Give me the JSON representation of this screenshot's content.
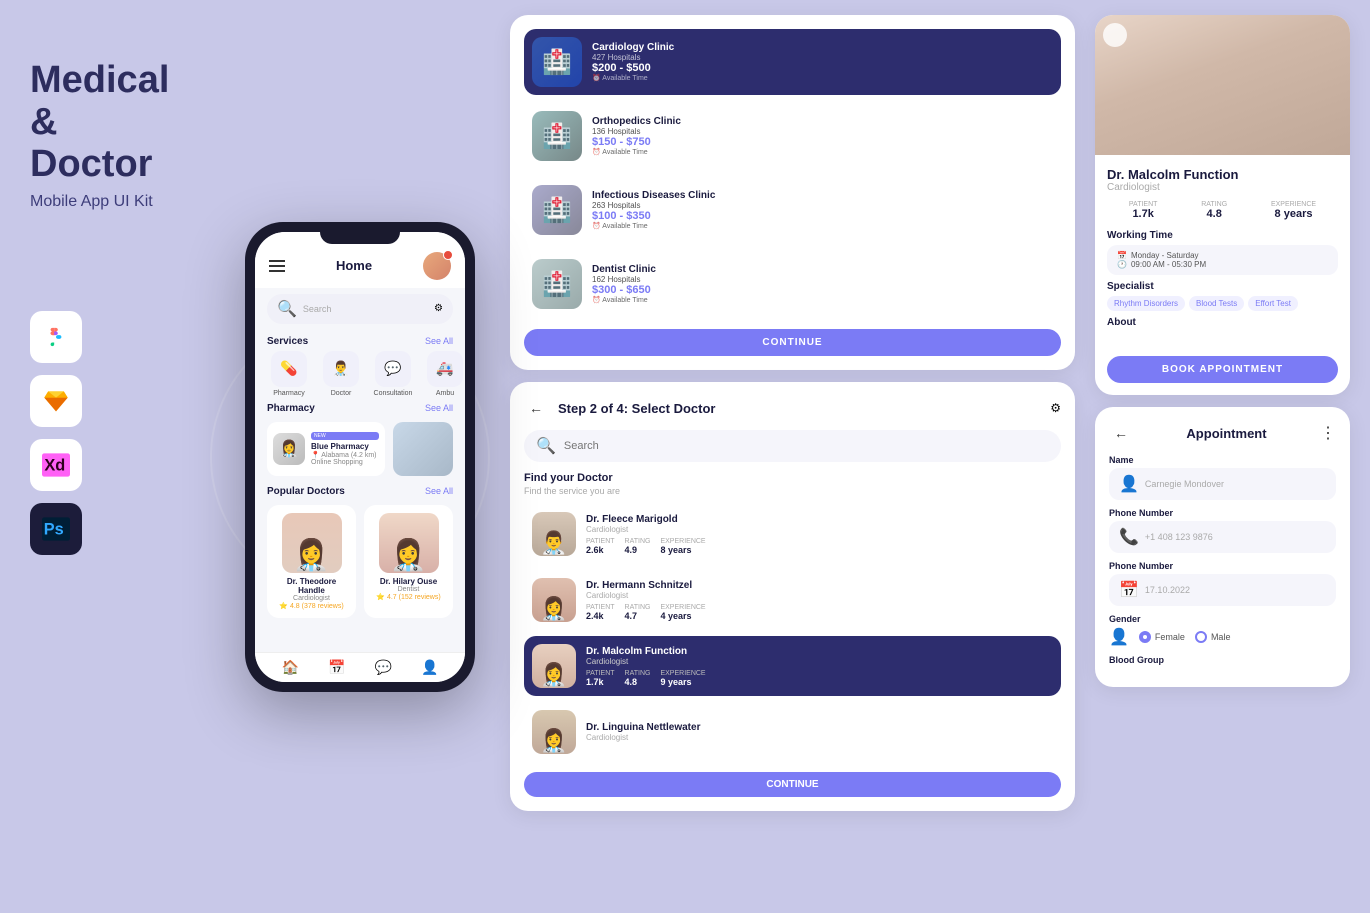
{
  "app": {
    "title": "Medical & Doctor",
    "subtitle": "Mobile App UI Kit"
  },
  "tools": [
    {
      "name": "Figma",
      "icon": "figma",
      "bg": "#fff"
    },
    {
      "name": "Sketch",
      "icon": "sketch",
      "bg": "#fff"
    },
    {
      "name": "XD",
      "icon": "xd",
      "bg": "#fff"
    },
    {
      "name": "Photoshop",
      "icon": "ps",
      "bg": "#1c1c3a"
    }
  ],
  "phone": {
    "header": {
      "title": "Home"
    },
    "search": {
      "placeholder": "Search"
    },
    "services": {
      "label": "Services",
      "see_all": "See All",
      "items": [
        {
          "name": "Pharmacy",
          "icon": "💊"
        },
        {
          "name": "Doctor",
          "icon": "👨‍⚕️"
        },
        {
          "name": "Consultation",
          "icon": "💬"
        },
        {
          "name": "Ambu",
          "icon": "🚑"
        }
      ]
    },
    "pharmacy": {
      "label": "Pharmacy",
      "see_all": "See All",
      "items": [
        {
          "badge": "NEW",
          "name": "Blue Pharmacy",
          "location": "Alabama (4.2 km)",
          "tag": "Online Shopping"
        }
      ]
    },
    "doctors": {
      "label": "Popular Doctors",
      "see_all": "See All",
      "items": [
        {
          "name": "Dr. Theodore Handle",
          "specialty": "Cardiologist",
          "rating": "4.8 (378 reviews)"
        },
        {
          "name": "Dr. Hilary Ouse",
          "specialty": "Dentist",
          "rating": "4.7 (152 reviews)"
        }
      ]
    }
  },
  "clinics_screen": {
    "items": [
      {
        "name": "Cardiology Clinic",
        "count": "427 Hospitals",
        "price": "$200 - $500",
        "avail": "Available Time",
        "featured": true
      },
      {
        "name": "Orthopedics Clinic",
        "count": "136 Hospitals",
        "price": "$150 - $750",
        "avail": "Available Time",
        "featured": false
      },
      {
        "name": "Infectious Diseases Clinic",
        "count": "263 Hospitals",
        "price": "$100 - $350",
        "avail": "Available Time",
        "featured": false
      },
      {
        "name": "Dentist Clinic",
        "count": "162 Hospitals",
        "price": "$300 - $650",
        "avail": "Available Time",
        "featured": false
      }
    ],
    "continue_btn": "CONTINUE"
  },
  "select_doctor_screen": {
    "step": "Step 2 of 4: Select Doctor",
    "search_placeholder": "Search",
    "find_title": "Find your Doctor",
    "find_subtitle": "Find the service you are",
    "doctors": [
      {
        "name": "Dr. Fleece Marigold",
        "specialty": "Cardiologist",
        "patient": "2.6k",
        "rating": "4.9",
        "experience": "8 years",
        "selected": false
      },
      {
        "name": "Dr. Hermann Schnitzel",
        "specialty": "Cardiologist",
        "patient": "2.4k",
        "rating": "4.7",
        "experience": "4 years",
        "selected": false
      },
      {
        "name": "Dr. Malcolm Function",
        "specialty": "Cardiologist",
        "patient": "1.7k",
        "rating": "4.8",
        "experience": "9 years",
        "selected": true
      },
      {
        "name": "Dr. Linguina Nettlewater",
        "specialty": "Cardiologist",
        "patient": "",
        "rating": "",
        "experience": "",
        "selected": false
      }
    ],
    "continue_btn": "CONTINUE"
  },
  "doctor_profile": {
    "name": "Dr. Malcolm Function",
    "specialty": "Cardiologist",
    "stats": {
      "patient": {
        "label": "PATIENT",
        "value": "1.7k"
      },
      "rating": {
        "label": "RATING",
        "value": "4.8"
      },
      "experience": {
        "label": "EXPERIENCE",
        "value": "8 years"
      }
    },
    "working_time": {
      "title": "Working Time",
      "days": "Monday - Saturday",
      "hours": "09:00 AM - 05:30 PM"
    },
    "specialist": {
      "title": "Specialist",
      "tags": [
        "Rhythm Disorders",
        "Blood Tests",
        "Effort Test"
      ]
    },
    "about": {
      "title": "About"
    },
    "book_btn": "BOOK APPOINTMENT"
  },
  "appointment": {
    "title": "Appointment",
    "fields": {
      "name": {
        "label": "Name",
        "placeholder": "Carnegie Mondover",
        "icon": "👤"
      },
      "phone": {
        "label": "Phone Number",
        "placeholder": "+1 408 123 9876",
        "icon": "📞"
      },
      "date": {
        "label": "Phone Number",
        "placeholder": "17.10.2022",
        "icon": "📅"
      },
      "gender": {
        "label": "Gender",
        "options": [
          "Female",
          "Male"
        ],
        "selected": "Female"
      },
      "blood": {
        "label": "Blood Group"
      }
    }
  }
}
